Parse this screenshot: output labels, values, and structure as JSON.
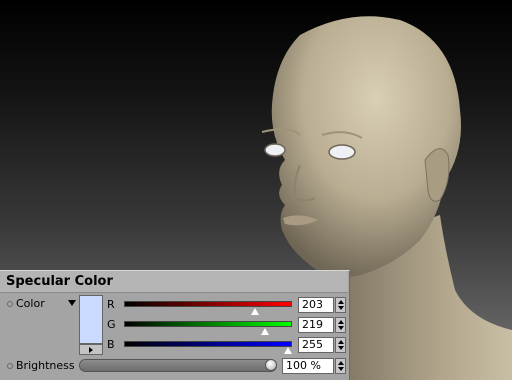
{
  "panel": {
    "title": "Specular Color",
    "color_label": "Color",
    "brightness_label": "Brightness",
    "brightness_value": "100 %",
    "brightness_fraction": 1.0
  },
  "color": {
    "swatch": "#cbdbff",
    "channels": [
      {
        "name": "R",
        "value": "203",
        "fraction": 0.796,
        "gradient_from": "#000000",
        "gradient_to": "#ff0000"
      },
      {
        "name": "G",
        "value": "219",
        "fraction": 0.859,
        "gradient_from": "#000000",
        "gradient_to": "#00ff00"
      },
      {
        "name": "B",
        "value": "255",
        "fraction": 1.0,
        "gradient_from": "#000000",
        "gradient_to": "#0000ff"
      }
    ]
  },
  "colors": {
    "skin": "#c8bca1",
    "eye_white": "#eef0f4"
  }
}
